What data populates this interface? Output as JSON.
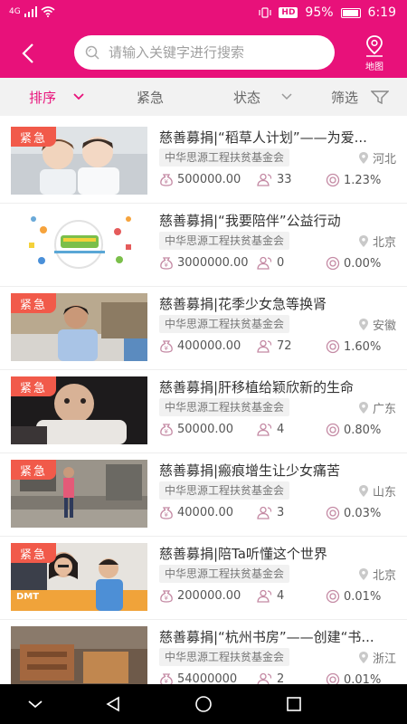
{
  "status": {
    "signal_label": "4G",
    "battery": "95%",
    "hd_badge": "HD",
    "time": "6:19"
  },
  "header": {
    "search_placeholder": "请输入关键字进行搜索",
    "map_label": "地图"
  },
  "filters": {
    "sort": "排序",
    "urgent": "紧急",
    "state": "状态",
    "filter": "筛选"
  },
  "colors": {
    "brand": "#e8117a",
    "urgent_tag": "#f15a4a"
  },
  "projects": [
    {
      "urgent_tag": "紧急",
      "title": "慈善募捐|“稻草人计划”——为爱...",
      "org": "中华思源工程扶贫基金会",
      "location": "河北",
      "amount": "500000.00",
      "donors": "33",
      "percent": "1.23%"
    },
    {
      "urgent_tag": "",
      "title": "慈善募捐|“我要陪伴”公益行动",
      "org": "中华思源工程扶贫基金会",
      "location": "北京",
      "amount": "3000000.00",
      "donors": "0",
      "percent": "0.00%"
    },
    {
      "urgent_tag": "紧急",
      "title": "慈善募捐|花季少女急等换肾",
      "org": "中华思源工程扶贫基金会",
      "location": "安徽",
      "amount": "400000.00",
      "donors": "72",
      "percent": "1.60%"
    },
    {
      "urgent_tag": "紧急",
      "title": "慈善募捐|肝移植给颖欣新的生命",
      "org": "中华思源工程扶贫基金会",
      "location": "广东",
      "amount": "50000.00",
      "donors": "4",
      "percent": "0.80%"
    },
    {
      "urgent_tag": "紧急",
      "title": "慈善募捐|瘢痕增生让少女痛苦",
      "org": "中华思源工程扶贫基金会",
      "location": "山东",
      "amount": "40000.00",
      "donors": "3",
      "percent": "0.03%"
    },
    {
      "urgent_tag": "紧急",
      "title": "慈善募捐|陪Ta听懂这个世界",
      "org": "中华思源工程扶贫基金会",
      "location": "北京",
      "amount": "200000.00",
      "donors": "4",
      "percent": "0.01%"
    },
    {
      "urgent_tag": "",
      "title": "慈善募捐|“杭州书房”——创建“书...",
      "org": "中华思源工程扶贫基金会",
      "location": "浙江",
      "amount": "54000000",
      "donors": "2",
      "percent": "0.01%"
    }
  ]
}
